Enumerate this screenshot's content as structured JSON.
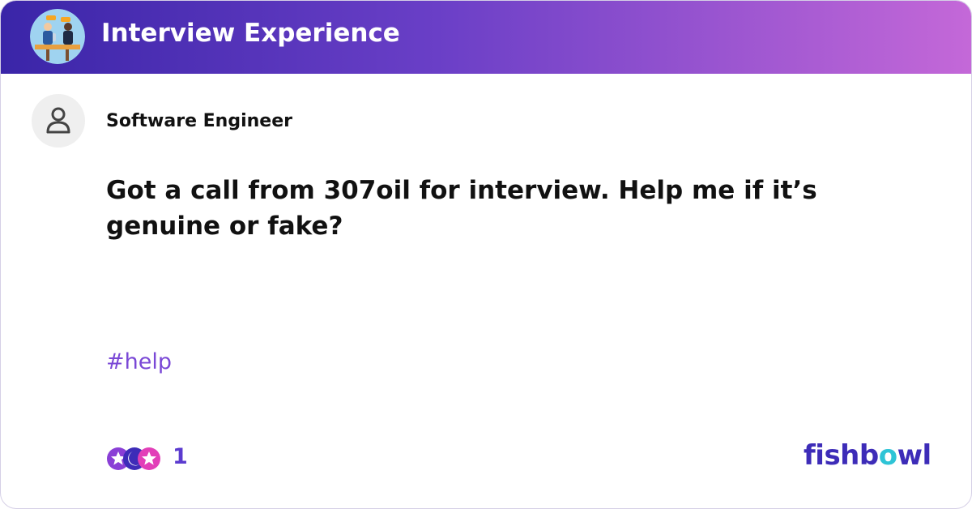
{
  "header": {
    "title": "Interview Experience",
    "icon": "interview-illustration-icon"
  },
  "post": {
    "author": "Software Engineer",
    "avatar_icon": "user-avatar-icon",
    "text": "Got a call from 307oil for interview. Help me if it’s genuine or fake?",
    "hashtag": "#help"
  },
  "reactions": {
    "count": "1",
    "icons": [
      "star-reaction-icon",
      "moon-reaction-icon",
      "star-reaction-icon"
    ]
  },
  "brand": {
    "prefix": "fishb",
    "o": "o",
    "suffix": "wl"
  },
  "colors": {
    "header_gradient_start": "#3a25a8",
    "header_gradient_end": "#c468d8",
    "hashtag": "#7a48d6",
    "brand": "#3d2cb8",
    "brand_accent": "#2ec4d6"
  }
}
